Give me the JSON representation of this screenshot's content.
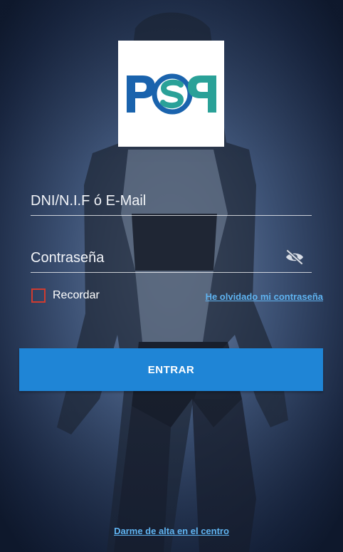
{
  "brand": {
    "logo_text": "PSP",
    "colors": {
      "blue": "#1a63ad",
      "green": "#2aa198",
      "accent": "#1f85d6",
      "link": "#5fb3f0",
      "checkbox_border": "#d03b2f"
    }
  },
  "login": {
    "user_placeholder": "DNI/N.I.F ó E-Mail",
    "password_placeholder": "Contraseña",
    "password_toggle_icon": "eye-off-icon",
    "remember_label": "Recordar",
    "remember_checked": false,
    "forgot_label": "He olvidado mi contraseña",
    "submit_label": "ENTRAR"
  },
  "footer": {
    "signup_label": "Darme de alta en el centro"
  }
}
